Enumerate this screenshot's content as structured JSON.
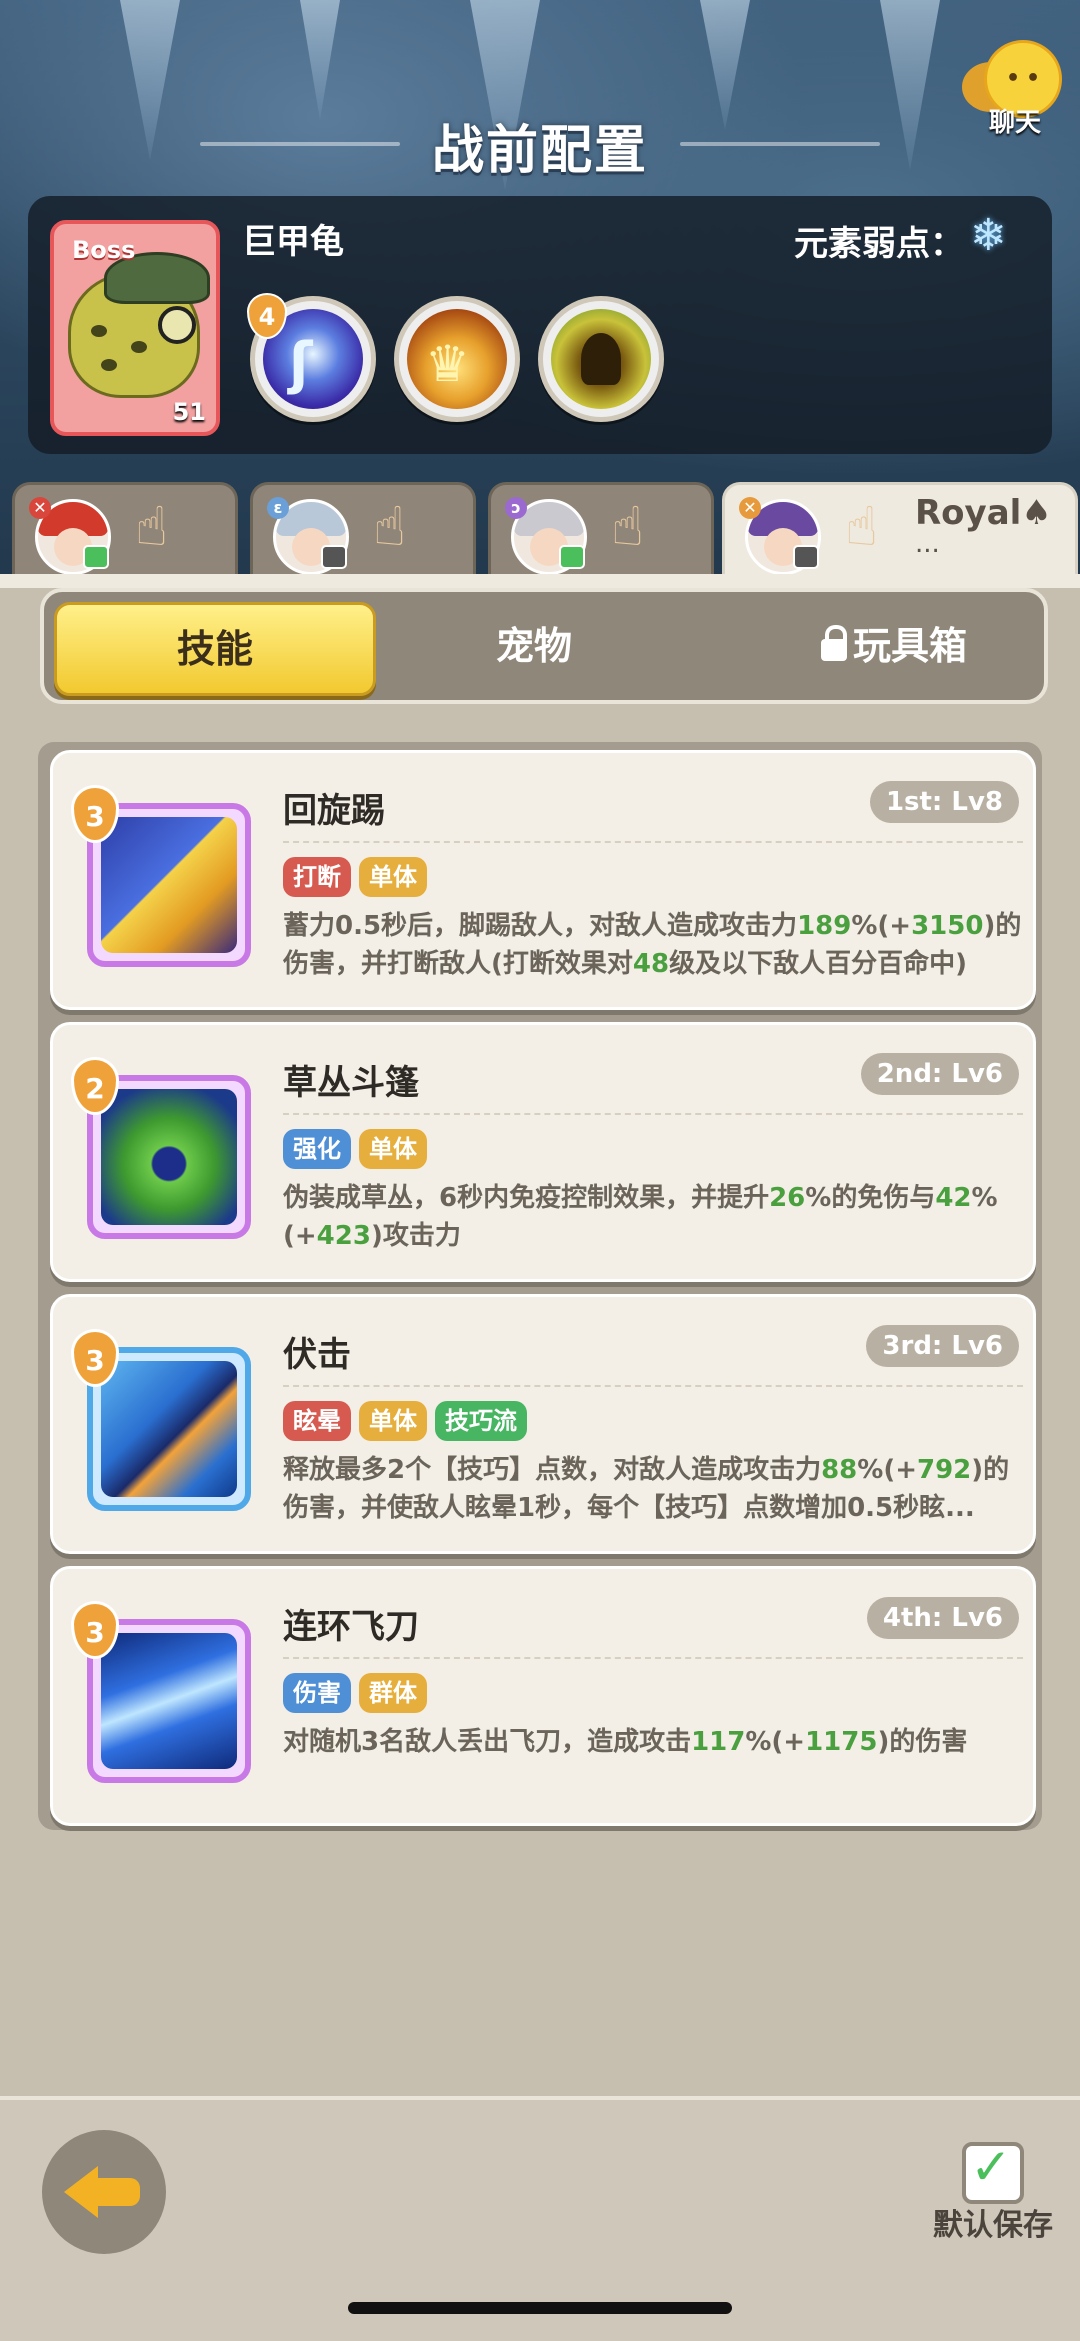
{
  "header": {
    "title": "战前配置",
    "chat_label": "聊天"
  },
  "boss": {
    "tag": "Boss",
    "name": "巨甲龟",
    "level": "51",
    "weakness_label": "元素弱点：",
    "weakness_icon": "snowflake-icon",
    "skills": [
      {
        "icon": "water-vortex-skill-icon",
        "cost": "4"
      },
      {
        "icon": "golden-crown-skill-icon"
      },
      {
        "icon": "dark-creature-skill-icon"
      }
    ]
  },
  "players": [
    {
      "name": "",
      "status": "green"
    },
    {
      "name": "",
      "status": "dark"
    },
    {
      "name": "",
      "status": "green"
    },
    {
      "name": "Royal♠",
      "extra": "...",
      "status": "dark"
    }
  ],
  "tabs": [
    {
      "label": "技能",
      "active": true
    },
    {
      "label": "宠物",
      "active": false
    },
    {
      "label": "玩具箱",
      "active": false,
      "locked": true
    }
  ],
  "skills": [
    {
      "name": "回旋踢",
      "slot": "1st: Lv8",
      "cost": "3",
      "tags": [
        {
          "text": "打断",
          "color": "red"
        },
        {
          "text": "单体",
          "color": "gold"
        }
      ],
      "desc_parts": [
        {
          "t": "蓄力0.5秒后，脚踢敌人，对敌人造成攻击力"
        },
        {
          "t": "189",
          "hl": true
        },
        {
          "t": "%(+"
        },
        {
          "t": "3150",
          "hl": true
        },
        {
          "t": ")的伤害，并打断敌人(打断效果对"
        },
        {
          "t": "48",
          "hl": true
        },
        {
          "t": "级及以下敌人百分百命中)"
        }
      ]
    },
    {
      "name": "草丛斗篷",
      "slot": "2nd: Lv6",
      "cost": "2",
      "tags": [
        {
          "text": "强化",
          "color": "blue"
        },
        {
          "text": "单体",
          "color": "gold"
        }
      ],
      "desc_parts": [
        {
          "t": "伪装成草丛，6秒内免疫控制效果，并提升"
        },
        {
          "t": "26",
          "hl": true
        },
        {
          "t": "%的免伤与"
        },
        {
          "t": "42",
          "hl": true
        },
        {
          "t": "%(+"
        },
        {
          "t": "423",
          "hl": true
        },
        {
          "t": ")攻击力"
        }
      ]
    },
    {
      "name": "伏击",
      "slot": "3rd: Lv6",
      "cost": "3",
      "tags": [
        {
          "text": "眩晕",
          "color": "red"
        },
        {
          "text": "单体",
          "color": "gold"
        },
        {
          "text": "技巧流",
          "color": "green"
        }
      ],
      "desc_parts": [
        {
          "t": "释放最多2个【技巧】点数，对敌人造成攻击力"
        },
        {
          "t": "88",
          "hl": true
        },
        {
          "t": "%(+"
        },
        {
          "t": "792",
          "hl": true
        },
        {
          "t": ")的伤害，并使敌人眩晕1秒，每个【技巧】点数增加0.5秒眩..."
        }
      ]
    },
    {
      "name": "连环飞刀",
      "slot": "4th: Lv6",
      "cost": "3",
      "tags": [
        {
          "text": "伤害",
          "color": "blue"
        },
        {
          "text": "群体",
          "color": "gold"
        }
      ],
      "desc_parts": [
        {
          "t": "对随机3名敌人丢出飞刀，造成攻击"
        },
        {
          "t": "117",
          "hl": true
        },
        {
          "t": "%(+"
        },
        {
          "t": "1175",
          "hl": true
        },
        {
          "t": ")的伤害"
        }
      ]
    }
  ],
  "footer": {
    "back_icon": "back-arrow-icon",
    "save_label": "默认保存",
    "save_checked": true
  }
}
